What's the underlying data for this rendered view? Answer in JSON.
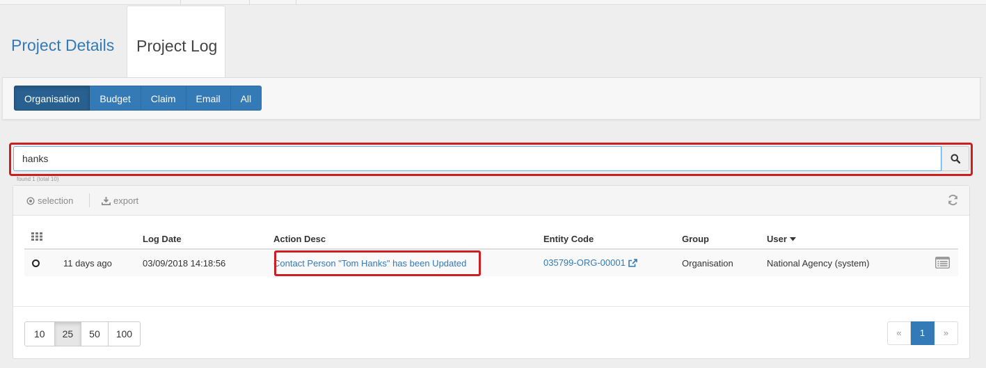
{
  "tabs": {
    "details": "Project Details",
    "log": "Project Log"
  },
  "filters": [
    {
      "label": "Organisation",
      "active": true
    },
    {
      "label": "Budget",
      "active": false
    },
    {
      "label": "Claim",
      "active": false
    },
    {
      "label": "Email",
      "active": false
    },
    {
      "label": "All",
      "active": false
    }
  ],
  "search": {
    "value": "hanks",
    "found_text": "found 1 (total 10)"
  },
  "toolbar": {
    "selection": "selection",
    "export": "export"
  },
  "table": {
    "columns": [
      "Log Date",
      "Action Desc",
      "Entity Code",
      "Group",
      "User"
    ],
    "sort_column": "User",
    "rows": [
      {
        "relative": "11 days ago",
        "log_date": "03/09/2018 14:18:56",
        "action_desc": "Contact Person \"Tom Hanks\" has been Updated",
        "entity_code": "035799-ORG-00001",
        "group": "Organisation",
        "user": "National Agency (system)"
      }
    ]
  },
  "pagination": {
    "page_sizes": [
      "10",
      "25",
      "50",
      "100"
    ],
    "active_page_size": "25",
    "prev": "«",
    "current_page": "1",
    "next": "»"
  },
  "colors": {
    "accent": "#337ab7",
    "highlight": "#cc1e23"
  }
}
